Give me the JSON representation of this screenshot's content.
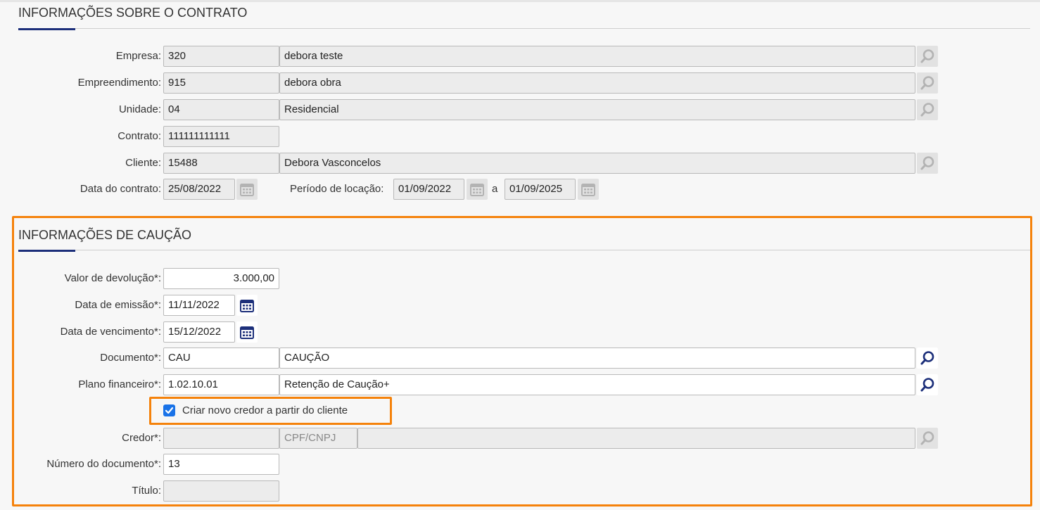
{
  "contract_section": {
    "title": "INFORMAÇÕES SOBRE O CONTRATO",
    "empresa": {
      "label": "Empresa:",
      "code": "320",
      "name": "debora teste"
    },
    "empreendimento": {
      "label": "Empreendimento:",
      "code": "915",
      "name": "debora obra"
    },
    "unidade": {
      "label": "Unidade:",
      "code": "04",
      "name": "Residencial"
    },
    "contrato": {
      "label": "Contrato:",
      "value": "111111111111"
    },
    "cliente": {
      "label": "Cliente:",
      "code": "15488",
      "name": "Debora Vasconcelos"
    },
    "data_contrato": {
      "label": "Data do contrato:",
      "value": "25/08/2022"
    },
    "periodo": {
      "label": "Período de locação:",
      "start": "01/09/2022",
      "separator": "a",
      "end": "01/09/2025"
    }
  },
  "caucao_section": {
    "title": "INFORMAÇÕES DE CAUÇÃO",
    "valor_devolucao": {
      "label": "Valor de devolução*:",
      "value": "3.000,00"
    },
    "data_emissao": {
      "label": "Data de emissão*:",
      "value": "11/11/2022"
    },
    "data_vencimento": {
      "label": "Data de vencimento*:",
      "value": "15/12/2022"
    },
    "documento": {
      "label": "Documento*:",
      "code": "CAU",
      "name": "CAUÇÃO"
    },
    "plano_financeiro": {
      "label": "Plano financeiro*:",
      "code": "1.02.10.01",
      "name": "Retenção de Caução+"
    },
    "criar_credor": {
      "label": "Criar novo credor a partir do cliente",
      "checked": true
    },
    "credor": {
      "label": "Credor*:",
      "code": "",
      "cpf_placeholder": "CPF/CNPJ",
      "name": ""
    },
    "numero_documento": {
      "label": "Número do documento*:",
      "value": "13"
    },
    "titulo": {
      "label": "Título:",
      "value": ""
    }
  },
  "colors": {
    "highlight": "#f5820b",
    "accent": "#1c2f7a",
    "checkbox": "#1a73e8"
  },
  "icons": {
    "search": "search-icon",
    "calendar": "calendar-icon",
    "check": "check-icon"
  }
}
